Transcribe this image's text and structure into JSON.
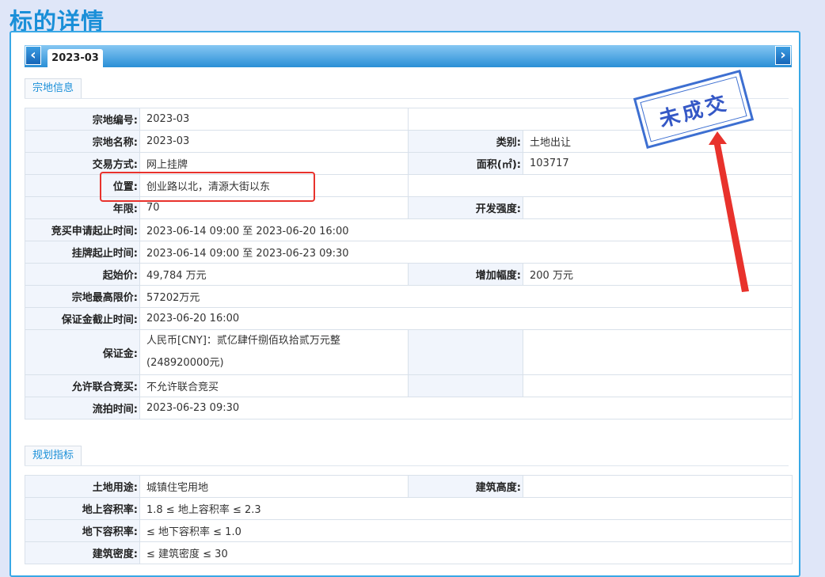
{
  "page_title": "标的详情",
  "tabs": {
    "active_label": "2023-03",
    "prev_icon": "chevron-left-icon",
    "next_icon": "chevron-right-icon"
  },
  "section1": {
    "title": "宗地信息",
    "rows": {
      "parcel_no": {
        "label": "宗地编号:",
        "value": "2023-03"
      },
      "parcel_name": {
        "label": "宗地名称:",
        "value": "2023-03"
      },
      "category": {
        "label": "类别:",
        "value": "土地出让"
      },
      "trade_method": {
        "label": "交易方式:",
        "value": "网上挂牌"
      },
      "area": {
        "label": "面积(㎡):",
        "value": "103717"
      },
      "location": {
        "label": "位置:",
        "value": "创业路以北，清源大街以东"
      },
      "term": {
        "label": "年限:",
        "value": "70"
      },
      "dev_intensity": {
        "label": "开发强度:",
        "value": ""
      },
      "apply_period": {
        "label": "竞买申请起止时间:",
        "value": "2023-06-14 09:00 至 2023-06-20 16:00"
      },
      "listing_period": {
        "label": "挂牌起止时间:",
        "value": "2023-06-14 09:00 至 2023-06-23 09:30"
      },
      "start_price": {
        "label": "起始价:",
        "value": "49,784 万元"
      },
      "increment": {
        "label": "增加幅度:",
        "value": "200 万元"
      },
      "max_price": {
        "label": "宗地最高限价:",
        "value": "57202万元"
      },
      "deposit_deadline": {
        "label": "保证金截止时间:",
        "value": "2023-06-20 16:00"
      },
      "deposit": {
        "label": "保证金:",
        "value_line1": "人民币[CNY]：贰亿肆仟捌佰玖拾贰万元整",
        "value_line2": "(248920000元)"
      },
      "joint_bid": {
        "label": "允许联合竞买:",
        "value": "不允许联合竞买"
      },
      "fail_time": {
        "label": "流拍时间:",
        "value": "2023-06-23 09:30"
      }
    }
  },
  "section2": {
    "title": "规划指标",
    "rows": {
      "land_use": {
        "label": "土地用途:",
        "value": "城镇住宅用地"
      },
      "bldg_height": {
        "label": "建筑高度:",
        "value": ""
      },
      "far_above": {
        "label": "地上容积率:",
        "value": "1.8 ≤ 地上容积率 ≤ 2.3"
      },
      "far_below": {
        "label": "地下容积率:",
        "value": "≤ 地下容积率 ≤ 1.0"
      },
      "density": {
        "label": "建筑密度:",
        "value": "≤ 建筑密度 ≤ 30"
      }
    }
  },
  "stamp": {
    "text": "未成交"
  },
  "colors": {
    "title_blue": "#1a8fd8",
    "annotation_red": "#e8322c",
    "stamp_blue": "#3558c6"
  }
}
